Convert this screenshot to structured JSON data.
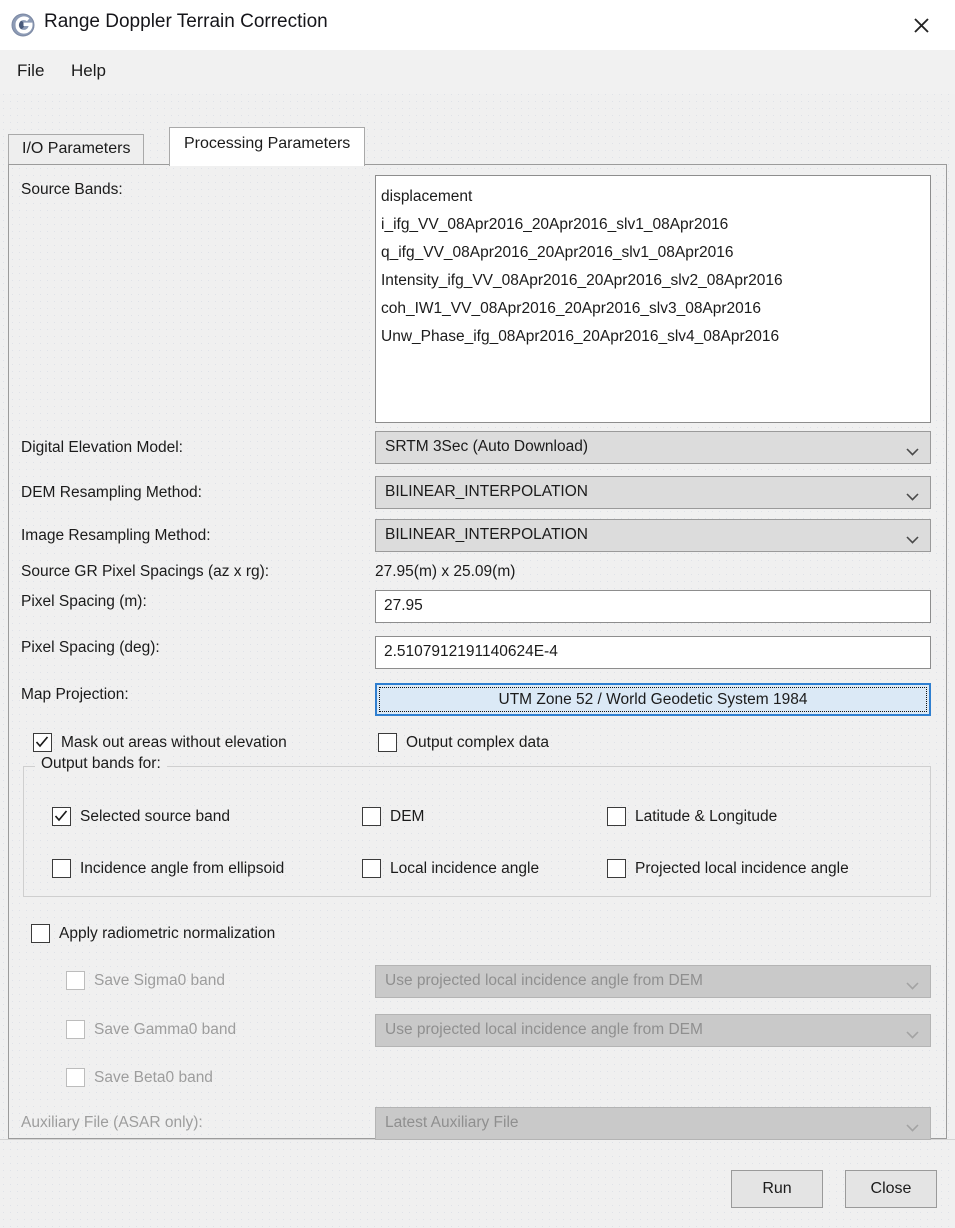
{
  "window": {
    "title": "Range Doppler Terrain Correction",
    "icon": "snap-app-icon",
    "close_icon": "close-icon"
  },
  "menubar": {
    "items": [
      {
        "label": "File"
      },
      {
        "label": "Help"
      }
    ]
  },
  "tabs": [
    {
      "label": "I/O Parameters",
      "active": false
    },
    {
      "label": "Processing Parameters",
      "active": true
    }
  ],
  "form": {
    "source_bands": {
      "label": "Source Bands:",
      "items": [
        "displacement",
        "i_ifg_VV_08Apr2016_20Apr2016_slv1_08Apr2016",
        "q_ifg_VV_08Apr2016_20Apr2016_slv1_08Apr2016",
        "Intensity_ifg_VV_08Apr2016_20Apr2016_slv2_08Apr2016",
        "coh_IW1_VV_08Apr2016_20Apr2016_slv3_08Apr2016",
        "Unw_Phase_ifg_08Apr2016_20Apr2016_slv4_08Apr2016"
      ]
    },
    "dem": {
      "label": "Digital Elevation Model:",
      "value": "SRTM 3Sec (Auto Download)"
    },
    "dem_resampling": {
      "label": "DEM Resampling Method:",
      "value": "BILINEAR_INTERPOLATION"
    },
    "image_resampling": {
      "label": "Image Resampling Method:",
      "value": "BILINEAR_INTERPOLATION"
    },
    "source_gr_spacings": {
      "label": "Source GR Pixel Spacings (az x rg):",
      "value": "27.95(m) x 25.09(m)"
    },
    "pixel_spacing_m": {
      "label": "Pixel Spacing (m):",
      "value": "27.95"
    },
    "pixel_spacing_deg": {
      "label": "Pixel Spacing (deg):",
      "value": "2.5107912191140624E-4"
    },
    "map_projection": {
      "label": "Map Projection:",
      "value": "UTM Zone 52 / World Geodetic System 1984"
    },
    "mask_out_areas": {
      "label": "Mask out areas without elevation",
      "checked": true
    },
    "output_complex": {
      "label": "Output complex data",
      "checked": false
    },
    "output_bands_group": {
      "legend": "Output bands for:",
      "checkboxes": [
        {
          "label": "Selected source band",
          "checked": true
        },
        {
          "label": "DEM",
          "checked": false
        },
        {
          "label": "Latitude & Longitude",
          "checked": false
        },
        {
          "label": "Incidence angle from ellipsoid",
          "checked": false
        },
        {
          "label": "Local incidence angle",
          "checked": false
        },
        {
          "label": "Projected local incidence angle",
          "checked": false
        }
      ]
    },
    "apply_radiometric_normalization": {
      "label": "Apply radiometric normalization",
      "checked": false
    },
    "save_sigma0": {
      "label": "Save Sigma0 band",
      "checked": false,
      "disabled": true
    },
    "sigma0_combo": {
      "value": "Use projected local incidence angle from DEM",
      "disabled": true
    },
    "save_gamma0": {
      "label": "Save Gamma0 band",
      "checked": false,
      "disabled": true
    },
    "gamma0_combo": {
      "value": "Use projected local incidence angle from DEM",
      "disabled": true
    },
    "save_beta0": {
      "label": "Save Beta0 band",
      "checked": false,
      "disabled": true
    },
    "auxiliary_file": {
      "label": "Auxiliary File (ASAR only):",
      "value": "Latest Auxiliary File",
      "disabled": true
    }
  },
  "footer": {
    "run_label": "Run",
    "close_label": "Close"
  },
  "colors": {
    "background": "#f0f0f0",
    "titlebar": "#ffffff",
    "accent_focus": "#2f7fd0",
    "focus_fill": "#dbe9f6",
    "combo_fill": "#dcdcdc",
    "disabled_text": "#9d9d9d"
  }
}
